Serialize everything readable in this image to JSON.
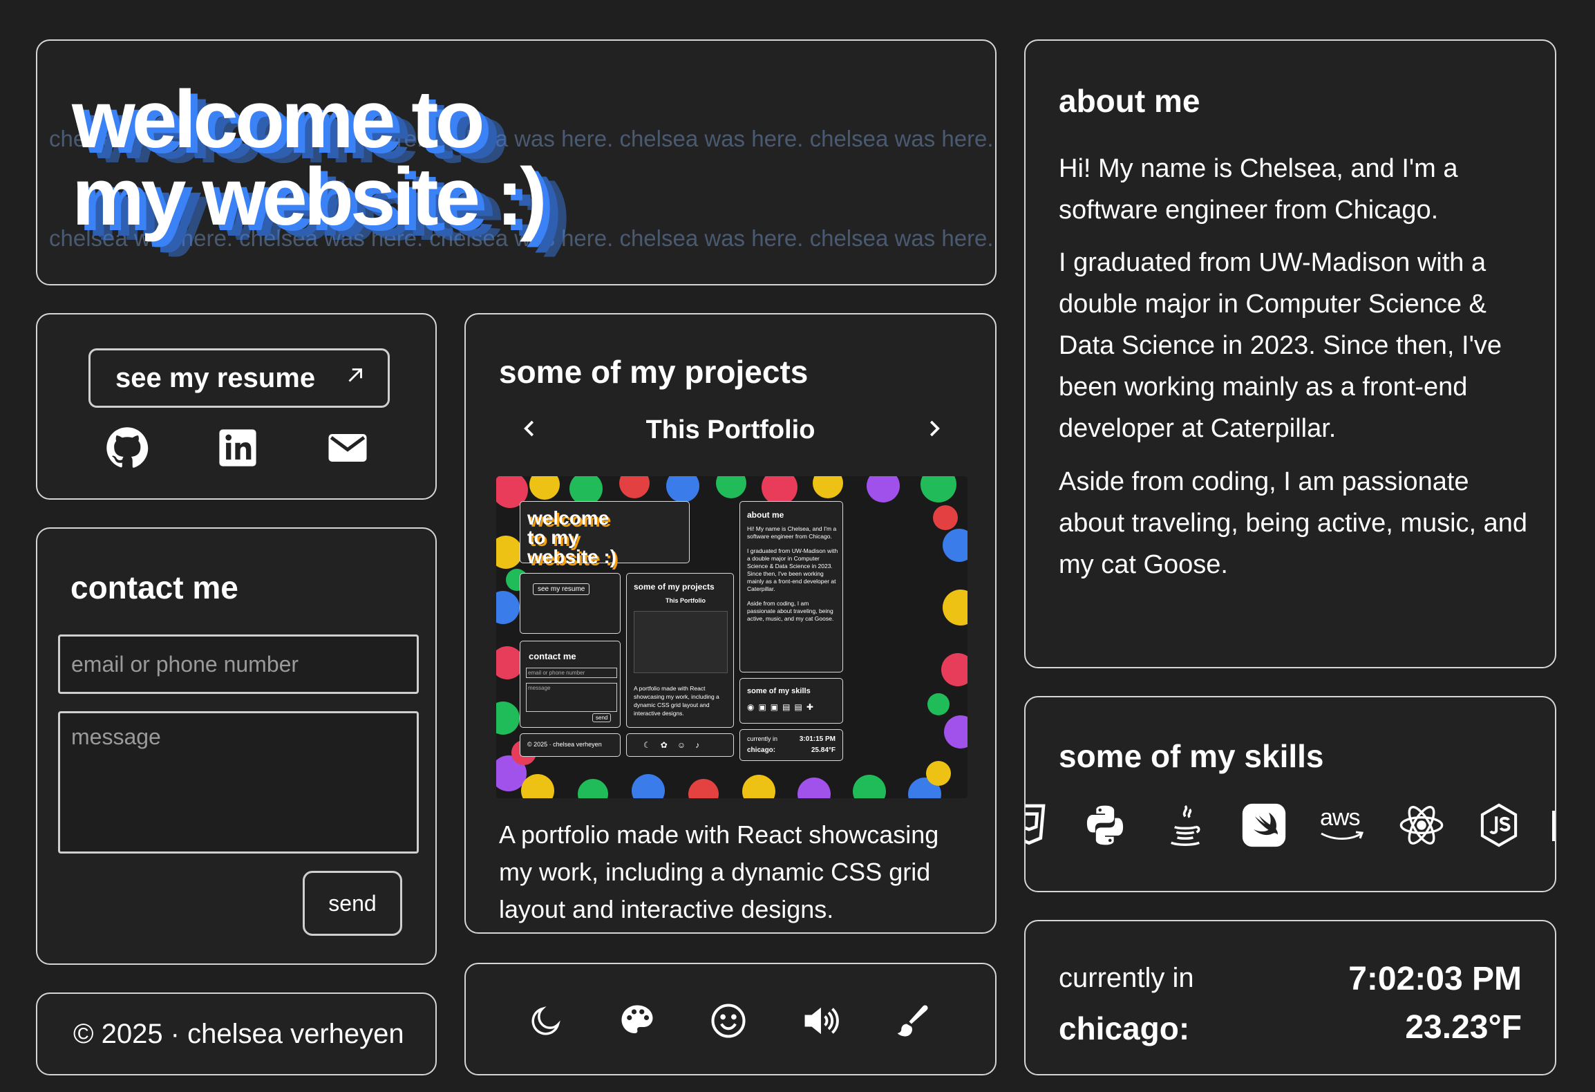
{
  "welcome": {
    "background_text": "chelsea was here. chelsea was here. chelsea was here. chelsea was here. chelsea was here.",
    "title_line1": "welcome to",
    "title_line2": "my website :)",
    "shadow_color": "#3b82f6"
  },
  "links": {
    "resume_label": "see my resume",
    "resume_icon": "arrow-up-right-icon",
    "social": [
      "github-icon",
      "linkedin-icon",
      "mail-icon"
    ]
  },
  "contact": {
    "title": "contact me",
    "contact_placeholder": "email or phone number",
    "message_placeholder": "message",
    "send_label": "send"
  },
  "footer": {
    "text": "© 2025 · chelsea verheyen"
  },
  "projects": {
    "title": "some of my projects",
    "current": "This Portfolio",
    "prev_icon": "chevron-left-icon",
    "next_icon": "chevron-right-icon",
    "description": "A portfolio made with React showcasing my work, including a dynamic CSS grid layout and interactive designs.",
    "preview": {
      "welcome": "welcome to my website :)",
      "about_title": "about me",
      "about_p1": "Hi! My name is Chelsea, and I'm a software engineer from Chicago.",
      "about_p2": "I graduated from UW-Madison with a double major in Computer Science & Data Science in 2023. Since then, I've been working mainly as a front-end developer at Caterpillar.",
      "about_p3": "Aside from coding, I am passionate about traveling, being active, music, and my cat Goose.",
      "resume": "see my resume",
      "projects_title": "some of my projects",
      "project_name": "This Portfolio",
      "project_desc": "A portfolio made with React showcasing my work, including a dynamic CSS grid layout and interactive designs.",
      "contact": "contact me",
      "contact_ph": "email or phone number",
      "message_ph": "message",
      "send": "send",
      "skills": "some of my skills",
      "footer": "© 2025 · chelsea verheyen",
      "currently": "currently in",
      "city": "chicago:",
      "time": "3:01:15 PM",
      "temp": "25.84°F"
    }
  },
  "toolbar": [
    "moon-icon",
    "palette-icon",
    "smiley-icon",
    "volume-icon",
    "paintbrush-icon"
  ],
  "about": {
    "title": "about me",
    "p1": "Hi! My name is Chelsea, and I'm a software engineer from Chicago.",
    "p2": "I graduated from UW-Madison with a double major in Computer Science & Data Science in 2023. Since then, I've been working mainly as a front-end developer at Caterpillar.",
    "p3": "Aside from coding, I am passionate about traveling, being active, music, and my cat Goose."
  },
  "skills": {
    "title": "some of my skills",
    "icons": [
      "css3-icon",
      "python-icon",
      "java-icon",
      "swift-icon",
      "aws-icon",
      "react-icon",
      "nodejs-icon"
    ],
    "aws_label": "aws"
  },
  "weather": {
    "label": "currently in",
    "city": "chicago:",
    "time": "7:02:03 PM",
    "temp": "23.23°F"
  }
}
